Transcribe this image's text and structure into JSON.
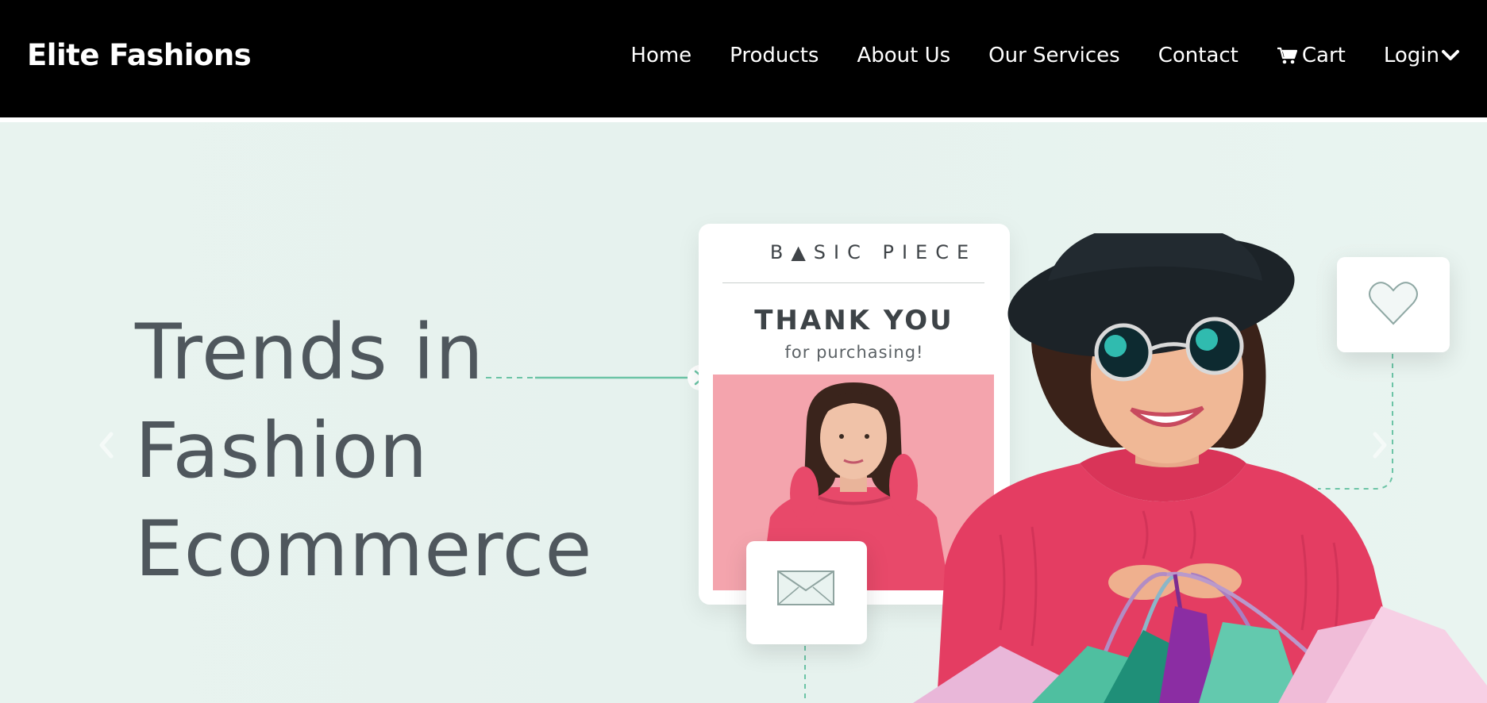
{
  "navbar": {
    "brand": "Elite Fashions",
    "links": [
      {
        "label": "Home"
      },
      {
        "label": "Products"
      },
      {
        "label": "About Us"
      },
      {
        "label": "Our Services"
      },
      {
        "label": "Contact"
      },
      {
        "label": "Cart",
        "icon": "shopping-cart-icon"
      },
      {
        "label": "Login",
        "icon": "chevron-down-icon"
      }
    ],
    "background": "#000000",
    "text_color": "#ffffff"
  },
  "hero": {
    "title_lines": [
      "Trends in",
      "Fashion",
      "Ecommerce"
    ],
    "title_color": "#4f575d",
    "background": "#e8f3ef",
    "accent": "#5fbf9f",
    "card": {
      "brand": "B▲SIC PIECE",
      "heading": "THANK YOU",
      "subheading": "for purchasing!"
    },
    "icons": [
      "chevron-left-icon",
      "chevron-right-icon",
      "heart-icon",
      "envelope-icon"
    ]
  }
}
